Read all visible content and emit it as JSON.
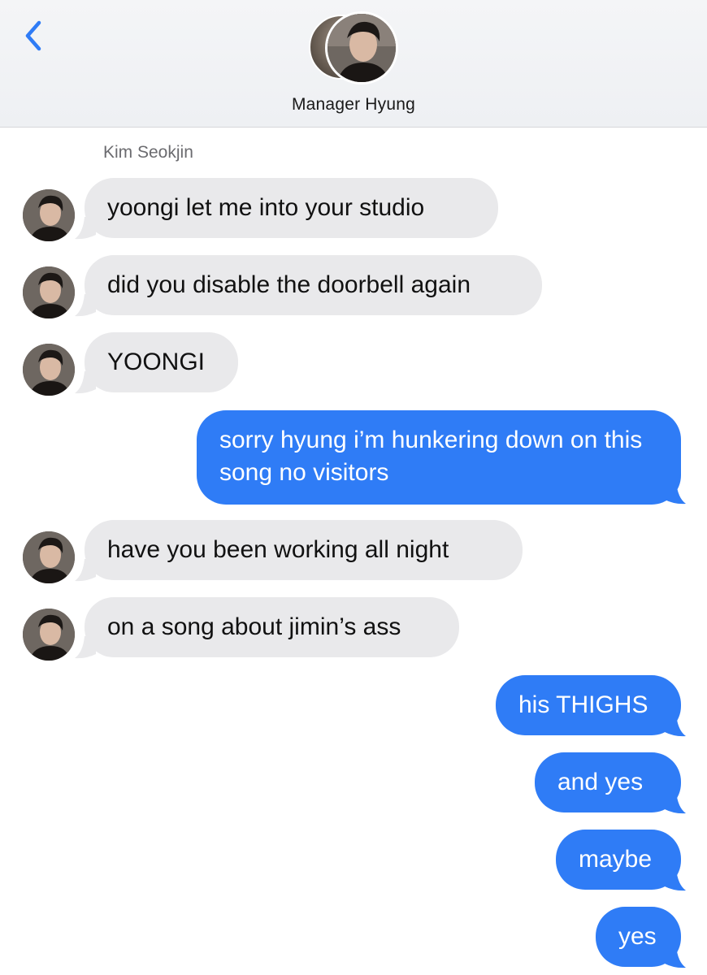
{
  "header": {
    "contact_name": "Manager Hyung"
  },
  "sender_label": "Kim Seokjin",
  "messages": [
    {
      "dir": "in",
      "text": "yoongi let me into your studio"
    },
    {
      "dir": "in",
      "text": "did you disable the doorbell again"
    },
    {
      "dir": "in",
      "text": "YOONGI"
    },
    {
      "dir": "out",
      "text": "sorry hyung i’m hunkering down on this song no visitors"
    },
    {
      "dir": "in",
      "text": "have you been working all night"
    },
    {
      "dir": "in",
      "text": "on a song about jimin’s ass"
    },
    {
      "dir": "out",
      "text": "his THIGHS"
    },
    {
      "dir": "out",
      "text": "and yes"
    },
    {
      "dir": "out",
      "text": "maybe"
    },
    {
      "dir": "out",
      "text": "yes"
    }
  ],
  "colors": {
    "incoming_bubble": "#e9e9eb",
    "outgoing_bubble": "#2f7cf6",
    "accent": "#2f7cf6"
  },
  "icons": {
    "back": "chevron-left-icon",
    "avatar": "contact-avatar"
  }
}
